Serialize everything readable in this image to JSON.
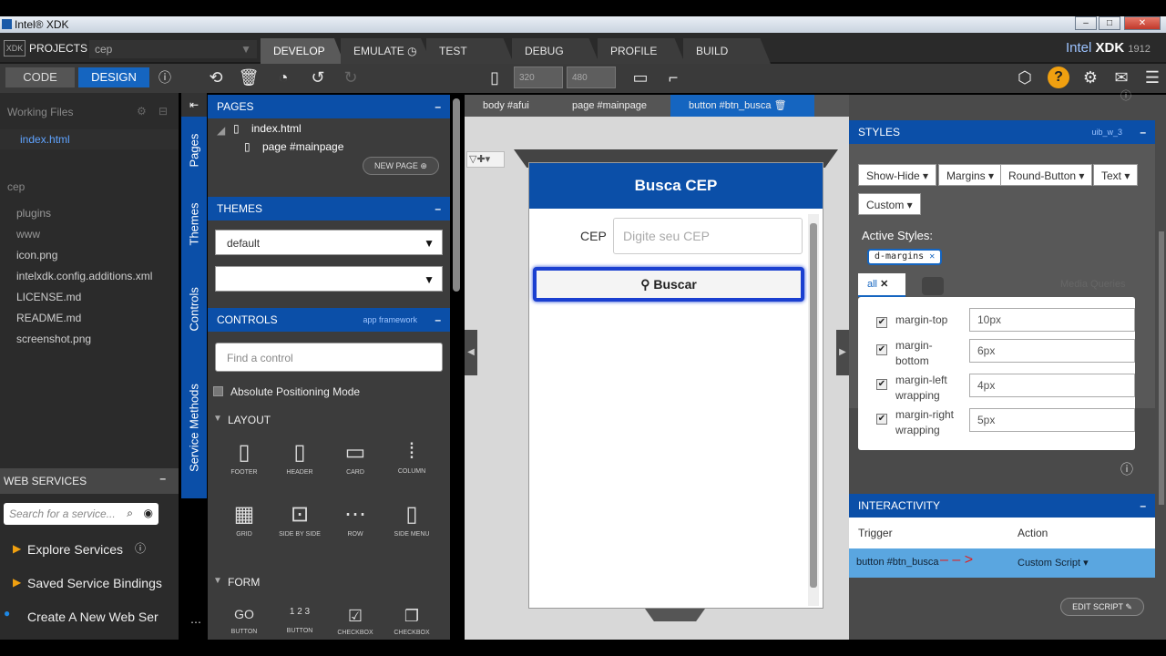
{
  "window": {
    "title": "Intel® XDK"
  },
  "topbar": {
    "projects_label": "PROJECTS",
    "project_name": "cep",
    "tabs": [
      "DEVELOP",
      "EMULATE",
      "TEST",
      "DEBUG",
      "PROFILE",
      "BUILD"
    ],
    "brand": "Intel",
    "brand_xdk": "XDK",
    "brand_version": "1912"
  },
  "toolbar": {
    "code_label": "CODE",
    "design_label": "DESIGN",
    "width_value": "320",
    "height_value": "480"
  },
  "left": {
    "working_files": "Working Files",
    "files_open": [
      "index.html"
    ],
    "project": "cep",
    "tree": [
      "plugins",
      "www",
      "icon.png",
      "intelxdk.config.additions.xml",
      "LICENSE.md",
      "README.md",
      "screenshot.png"
    ],
    "web_services": "WEB SERVICES",
    "search_placeholder": "Search for a service...",
    "explore": "Explore Services",
    "saved": "Saved Service Bindings",
    "create": "Create A New Web Ser"
  },
  "vtabs": [
    "Pages",
    "Themes",
    "Controls",
    "Service Methods"
  ],
  "pages": {
    "title": "PAGES",
    "file": "index.html",
    "page": "page #mainpage",
    "new_page": "NEW PAGE"
  },
  "themes": {
    "title": "THEMES",
    "selected": "default",
    "second": ""
  },
  "controls": {
    "title": "CONTROLS",
    "framework": "app framework",
    "find_placeholder": "Find a control",
    "abs_mode": "Absolute Positioning Mode",
    "layout": "LAYOUT",
    "layout_items": [
      "FOOTER",
      "HEADER",
      "CARD",
      "COLUMN",
      "GRID",
      "SIDE BY SIDE",
      "ROW",
      "SIDE MENU"
    ],
    "form": "FORM",
    "form_items": [
      "BUTTON",
      "BUTTON",
      "CHECKBOX",
      "CHECKBOX"
    ]
  },
  "crumbs": [
    "body #afui",
    "page #mainpage",
    "button #btn_busca"
  ],
  "phone": {
    "header": "Busca CEP",
    "cep_label": "CEP",
    "cep_placeholder": "Digite seu CEP",
    "button": "Buscar"
  },
  "styles": {
    "title": "STYLES",
    "id": "uib_w_3",
    "chips": [
      "Show-Hide",
      "Margins",
      "Round-Button",
      "Text",
      "Custom"
    ],
    "active_label": "Active Styles:",
    "active_chip": "d-margins",
    "tab_all": "all",
    "media": "Media Queries",
    "props": [
      {
        "label": "margin-top",
        "value": "10px"
      },
      {
        "label": "margin-bottom",
        "value": "6px"
      },
      {
        "label": "margin-left wrapping",
        "value": "4px"
      },
      {
        "label": "margin-right wrapping",
        "value": "5px"
      }
    ]
  },
  "interactivity": {
    "title": "INTERACTIVITY",
    "trigger_h": "Trigger",
    "action_h": "Action",
    "trigger": "button #btn_busca",
    "action": "Custom Script",
    "edit": "EDIT SCRIPT"
  }
}
